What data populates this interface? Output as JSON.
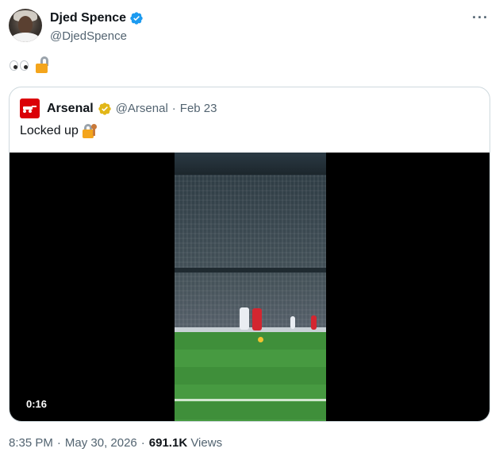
{
  "author": {
    "name": "Djed Spence",
    "handle": "@DjedSpence",
    "verified": true
  },
  "tweet": {
    "emoji": [
      "eyes",
      "unlocked-padlock"
    ]
  },
  "quoted_tweet": {
    "name": "Arsenal",
    "handle": "@Arsenal",
    "separator": "·",
    "date": "Feb 23",
    "verified": "gold",
    "text": "Locked up",
    "text_emoji": "locked-with-key",
    "video": {
      "duration": "0:16"
    }
  },
  "meta": {
    "time": "8:35 PM",
    "separator": "·",
    "date": "May 30, 2026",
    "separator2": "·",
    "views_count": "691.1K",
    "views_label": "Views"
  },
  "colors": {
    "verified_blue": "#1d9bf0",
    "verified_gold": "#e2b719",
    "arsenal_red": "#db0007",
    "secondary_text": "#536471"
  }
}
